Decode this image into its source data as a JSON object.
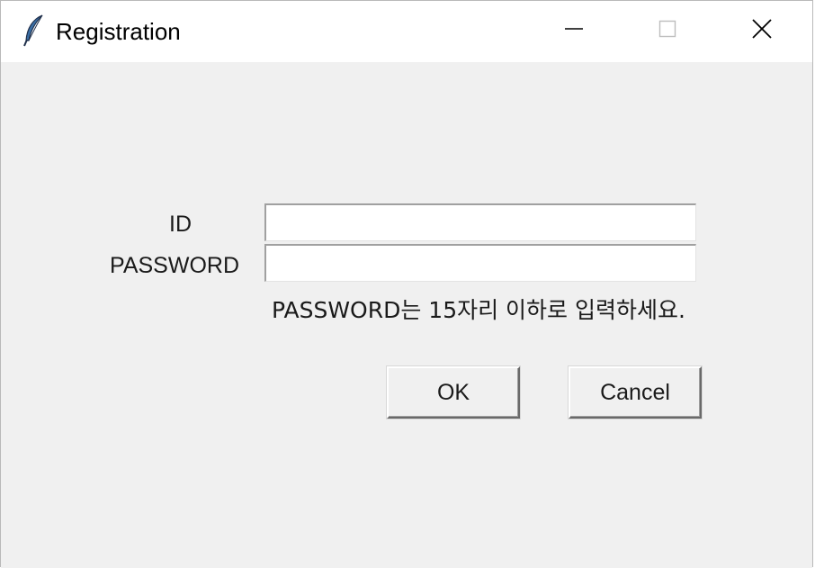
{
  "window": {
    "title": "Registration",
    "controls": {
      "minimize": "minimize-icon",
      "maximize": "maximize-icon",
      "close": "close-icon"
    },
    "app_icon": "feather-icon"
  },
  "form": {
    "id_label": "ID",
    "id_value": "",
    "password_label": "PASSWORD",
    "password_value": "",
    "hint": "PASSWORD는 15자리 이하로 입력하세요."
  },
  "buttons": {
    "ok_label": "OK",
    "cancel_label": "Cancel"
  },
  "colors": {
    "titlebar_bg": "#ffffff",
    "client_bg": "#f0f0f0",
    "feather_blue": "#3a6ea5"
  }
}
